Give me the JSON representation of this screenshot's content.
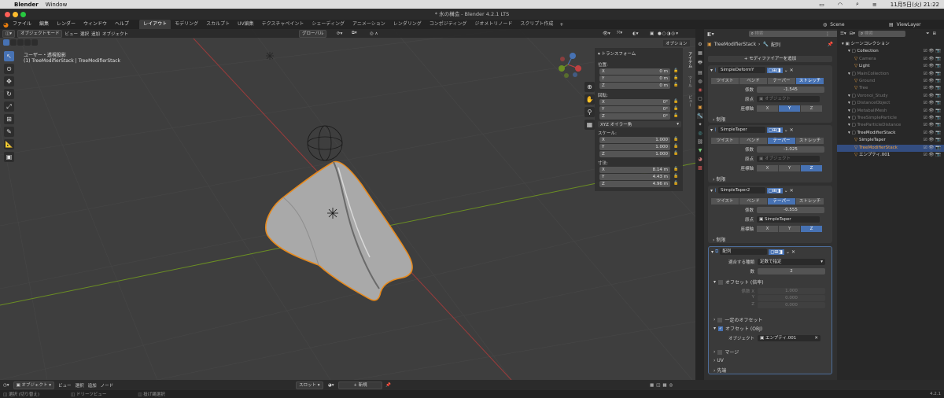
{
  "macbar": {
    "apple": "",
    "app": "Blender",
    "menu": "Window",
    "clock": "11月5日(火) 21:22"
  },
  "titlebar": {
    "title": "* 氷の構造 - Blender 4.2.1 LTS"
  },
  "menus": [
    "ファイル",
    "編集",
    "レンダー",
    "ウィンドウ",
    "ヘルプ"
  ],
  "workspaces": [
    "レイアウト",
    "モデリング",
    "スカルプト",
    "UV編集",
    "テクスチャペイント",
    "シェーディング",
    "アニメーション",
    "レンダリング",
    "コンポジティング",
    "ジオメトリノード",
    "スクリプト作成"
  ],
  "scene": {
    "scene_name": "Scene",
    "view_layer": "ViewLayer"
  },
  "viewport_header": {
    "mode": "オブジェクトモード",
    "view": "ビュー",
    "select": "選択",
    "add": "追加",
    "object": "オブジェクト",
    "transform": "グローバル",
    "options": "オプション"
  },
  "viewport_info": {
    "line1": "ユーザー・透視投影",
    "line2": "(1) TreeModifierStack | TreeModifierStack"
  },
  "npanel": {
    "title": "トランスフォーム",
    "loc_label": "位置:",
    "loc": [
      {
        "a": "X",
        "v": "0 m"
      },
      {
        "a": "Y",
        "v": "0 m"
      },
      {
        "a": "Z",
        "v": "0 m"
      }
    ],
    "rot_label": "回転:",
    "rot": [
      {
        "a": "X",
        "v": "0°"
      },
      {
        "a": "Y",
        "v": "0°"
      },
      {
        "a": "Z",
        "v": "0°"
      }
    ],
    "rot_mode": "XYZ オイラー角",
    "scale_label": "スケール:",
    "scale": [
      {
        "a": "X",
        "v": "1.000"
      },
      {
        "a": "Y",
        "v": "1.000"
      },
      {
        "a": "Z",
        "v": "1.000"
      }
    ],
    "dim_label": "寸法:",
    "dim": [
      {
        "a": "X",
        "v": "8.14 m"
      },
      {
        "a": "Y",
        "v": "4.43 m"
      },
      {
        "a": "Z",
        "v": "4.96 m"
      }
    ],
    "tabs": [
      "アイテム",
      "ツール",
      "ビュー"
    ]
  },
  "props": {
    "search_placeholder": "検索",
    "object": "TreeModifierStack",
    "section": "配列",
    "add_modifier": "モディファイアーを追加",
    "deform_modes": [
      "ツイスト",
      "ベンド",
      "テーパー",
      "ストレッチ"
    ],
    "coef_label": "係数",
    "origin_label": "原点",
    "axis_label": "座標軸",
    "limit_label": "制限",
    "axes": [
      "X",
      "Y",
      "Z"
    ],
    "mod1": {
      "name": "SimpleDeformY",
      "coef": "-1.545",
      "origin": "オブジェクト"
    },
    "mod2": {
      "name": "SimpleTaper",
      "coef": "-1.025",
      "origin": "オブジェクト"
    },
    "mod3": {
      "name": "SimpleTaper2",
      "coef": "-0.555",
      "origin": "SimpleTaper"
    },
    "mod4": {
      "name": "配列",
      "fit_label": "適合する種類",
      "fit_value": "定数で指定",
      "count_label": "数",
      "count": "2",
      "relative_offset": "オフセット (倍率)",
      "factor_label": "係数 X",
      "factors": [
        "1.000",
        "0.000",
        "0.000"
      ],
      "y_label": "Y",
      "z_label": "Z",
      "constant_offset": "一定のオフセット",
      "object_offset": "オフセット (OBJ)",
      "object_label": "オブジェクト",
      "object_value": "エンプティ.001",
      "merge": "マージ",
      "uv": "UV",
      "caps": "先端"
    }
  },
  "outliner": {
    "search_placeholder": "検索",
    "rows": [
      {
        "t": "シーンコレクション",
        "d": 0
      },
      {
        "t": "Collection",
        "d": 1
      },
      {
        "t": "Camera",
        "d": 2,
        "dim": true
      },
      {
        "t": "Light",
        "d": 2
      },
      {
        "t": "MainCollection",
        "d": 1,
        "dim": true
      },
      {
        "t": "Ground",
        "d": 2,
        "dim": true
      },
      {
        "t": "Tree",
        "d": 2,
        "dim": true
      },
      {
        "t": "Voronoi_Study",
        "d": 1,
        "dim": true
      },
      {
        "t": "DistanceObject",
        "d": 1,
        "dim": true
      },
      {
        "t": "MetaballMesh",
        "d": 1,
        "dim": true
      },
      {
        "t": "TreeSimpleParticle",
        "d": 1,
        "dim": true
      },
      {
        "t": "TreeParticleDistance",
        "d": 1,
        "dim": true
      },
      {
        "t": "TreeModifierStack",
        "d": 1
      },
      {
        "t": "SimpleTaper",
        "d": 2
      },
      {
        "t": "TreeModifierStack",
        "d": 2,
        "sel": true
      },
      {
        "t": "エンプティ.001",
        "d": 2
      }
    ]
  },
  "bottombar": {
    "mode": "オブジェクト",
    "view": "ビュー",
    "select": "選択",
    "add": "追加",
    "node": "ノード",
    "slot": "スロット",
    "new": "新規"
  },
  "statusbar": {
    "select": "選択 (切り替え)",
    "pan": "ドリーツビュー",
    "box": "投げ縄選択",
    "version": "4.2.1"
  }
}
